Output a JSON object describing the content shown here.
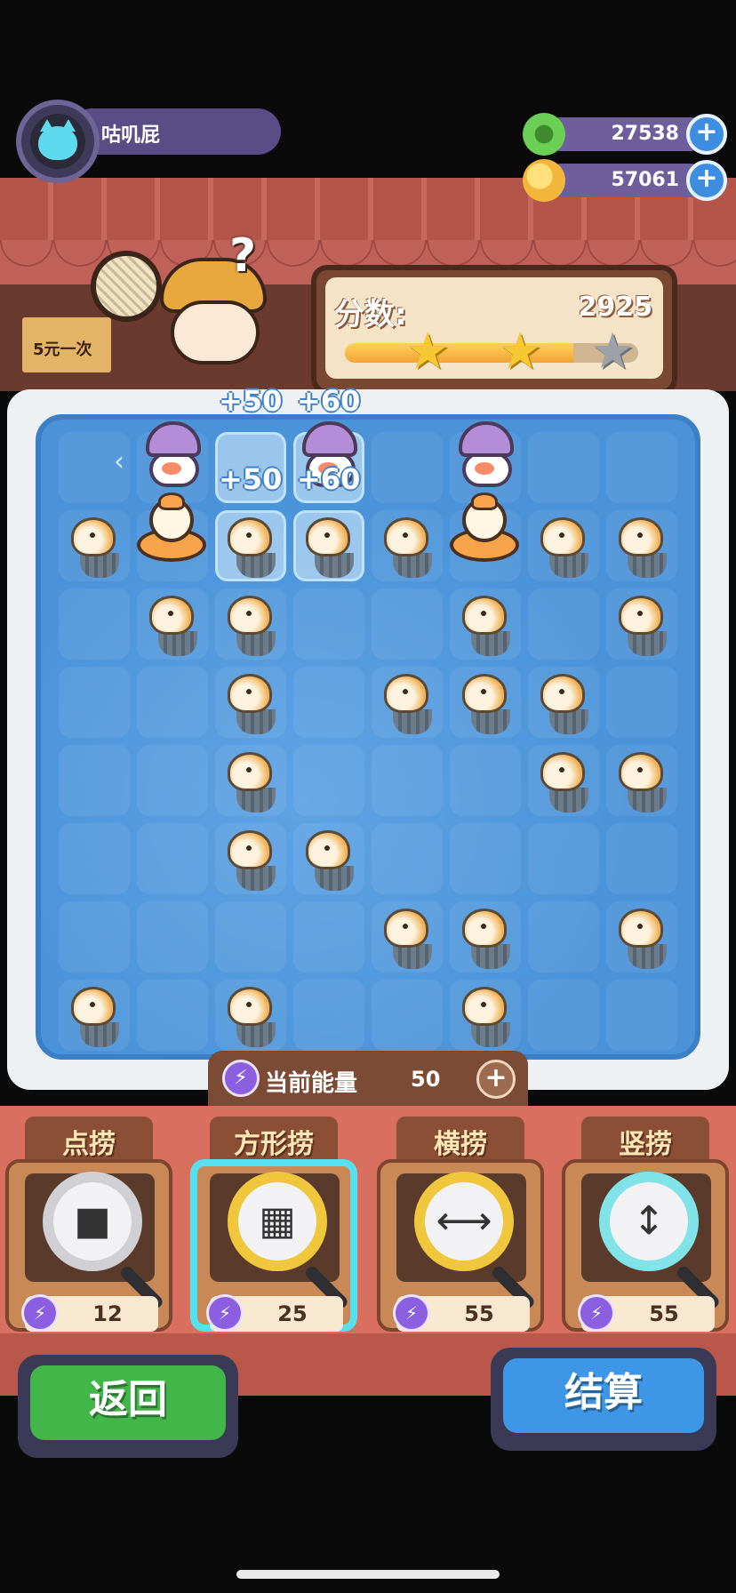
{
  "player": {
    "name": "咕叽屁",
    "avatar_icon": "cat-avatar-icon"
  },
  "currencies": [
    {
      "icon": "green-gem-icon",
      "value": "27538",
      "color": "#6ccf55"
    },
    {
      "icon": "gold-coin-icon",
      "value": "57061",
      "color": "#f3b63a"
    }
  ],
  "sign": {
    "text": "5元一次"
  },
  "score": {
    "label": "分数:",
    "value": "2925",
    "progress": 0.78,
    "stars": [
      true,
      true,
      false
    ]
  },
  "board": {
    "columns": 8,
    "rows": 8,
    "selected_cells": [
      [
        0,
        2
      ],
      [
        0,
        3
      ],
      [
        1,
        2
      ],
      [
        1,
        3
      ]
    ],
    "jellyfish": [
      [
        1,
        0
      ],
      [
        1,
        2
      ],
      [
        1,
        3
      ],
      [
        1,
        4
      ],
      [
        1,
        6
      ],
      [
        1,
        7
      ],
      [
        2,
        1
      ],
      [
        2,
        2
      ],
      [
        2,
        5
      ],
      [
        2,
        7
      ],
      [
        3,
        2
      ],
      [
        3,
        4
      ],
      [
        3,
        5
      ],
      [
        3,
        6
      ],
      [
        4,
        2
      ],
      [
        4,
        6
      ],
      [
        4,
        7
      ],
      [
        5,
        2
      ],
      [
        5,
        3
      ],
      [
        6,
        4
      ],
      [
        6,
        5
      ],
      [
        6,
        7
      ],
      [
        7,
        0
      ],
      [
        7,
        2
      ],
      [
        7,
        5
      ]
    ],
    "helmet_birds": [
      [
        0,
        1
      ],
      [
        0,
        3
      ],
      [
        0,
        5
      ]
    ],
    "ring_ducks": [
      [
        1,
        1
      ],
      [
        1,
        5
      ]
    ],
    "score_popups": [
      "+50",
      "+60",
      "+50",
      "+60"
    ]
  },
  "energy": {
    "label": "当前能量",
    "value": "50"
  },
  "tools": [
    {
      "name": "点捞",
      "symbol": "■",
      "cost": "12",
      "active": false,
      "ring_color": "#cfcfd4"
    },
    {
      "name": "方形捞",
      "symbol": "▦",
      "cost": "25",
      "active": true,
      "ring_color": "#f0c63c"
    },
    {
      "name": "横捞",
      "symbol": "⟷",
      "cost": "55",
      "active": false,
      "ring_color": "#f0c63c"
    },
    {
      "name": "竖捞",
      "symbol": "↕",
      "cost": "55",
      "active": false,
      "ring_color": "#7fe3e8"
    }
  ],
  "buttons": {
    "back": {
      "label": "返回",
      "color": "#43b64a"
    },
    "settle": {
      "label": "结算",
      "color": "#3d97e6"
    }
  }
}
